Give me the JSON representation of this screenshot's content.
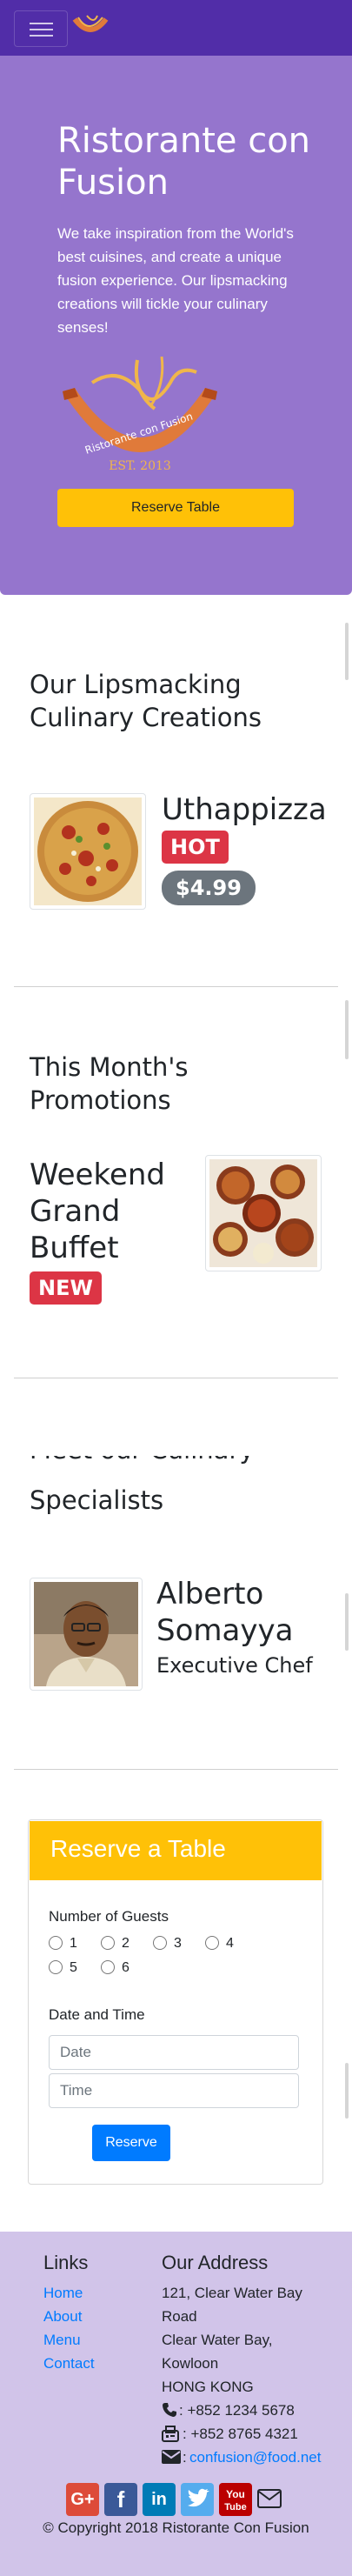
{
  "brand": {
    "logo_text": "Ristorante con Fusion",
    "logo_est": "EST. 2013",
    "colors": {
      "primary": "#512da8",
      "jumbotron": "#9575cd",
      "footer": "#d1c4e9",
      "warning": "#ffc107",
      "danger": "#dc3545",
      "secondary": "#6c757d",
      "link": "#007bff"
    }
  },
  "navbar": {
    "toggler_icon": "hamburger-icon"
  },
  "jumbotron": {
    "title": "Ristorante con Fusion",
    "text": "We take inspiration from the World's best cuisines, and create a unique fusion experience. Our lipsmacking creations will tickle your culinary senses!",
    "reserve_button": "Reserve Table"
  },
  "dish_section": {
    "heading": "Our Lipsmacking Culinary Creations",
    "name": "Uthappizza",
    "badge": "HOT",
    "price": "$4.99"
  },
  "promo_section": {
    "heading": "This Month's Promotions",
    "name": "Weekend Grand Buffet",
    "badge": "NEW"
  },
  "leader_section": {
    "heading_partial": "Meet our Culinary",
    "heading_visible": "Specialists",
    "name": "Alberto Somayya",
    "designation": "Executive Chef"
  },
  "reserve_form": {
    "title": "Reserve a Table",
    "guests_label": "Number of Guests",
    "guest_options": [
      "1",
      "2",
      "3",
      "4",
      "5",
      "6"
    ],
    "datetime_label": "Date and Time",
    "date_placeholder": "Date",
    "time_placeholder": "Time",
    "submit_label": "Reserve"
  },
  "footer": {
    "links_heading": "Links",
    "links": [
      "Home",
      "About",
      "Menu",
      "Contact"
    ],
    "address_heading": "Our Address",
    "address_lines": [
      "121, Clear Water Bay",
      "Road",
      "Clear Water Bay,",
      "Kowloon",
      "HONG KONG"
    ],
    "phone": ": +852 1234 5678",
    "fax": ": +852 8765 4321",
    "email": "confusion@food.net",
    "social": [
      {
        "icon": "google-plus-icon",
        "glyph": "G+",
        "color": "#dd4b39"
      },
      {
        "icon": "facebook-icon",
        "glyph": "f",
        "color": "#3b5998"
      },
      {
        "icon": "linkedin-icon",
        "glyph": "in",
        "color": "#007bb6"
      },
      {
        "icon": "twitter-icon",
        "glyph": "t",
        "color": "#55acee"
      },
      {
        "icon": "youtube-icon",
        "glyph": "You",
        "color": "#bb0000"
      },
      {
        "icon": "mail-icon",
        "glyph": "✉",
        "color": "#212529"
      }
    ],
    "copyright": "© Copyright 2018 Ristorante Con Fusion"
  }
}
